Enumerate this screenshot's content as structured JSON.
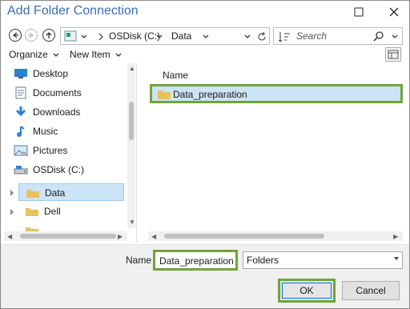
{
  "window": {
    "title": "Add Folder Connection"
  },
  "address": {
    "crumbs": [
      "OSDisk (C:)",
      "Data"
    ],
    "search_placeholder": "Search"
  },
  "toolbar": {
    "organize_label": "Organize",
    "new_item_label": "New Item"
  },
  "sidebar": {
    "items": [
      {
        "label": "Desktop",
        "icon": "desktop-icon"
      },
      {
        "label": "Documents",
        "icon": "documents-icon"
      },
      {
        "label": "Downloads",
        "icon": "downloads-icon"
      },
      {
        "label": "Music",
        "icon": "music-icon"
      },
      {
        "label": "Pictures",
        "icon": "pictures-icon"
      },
      {
        "label": "OSDisk (C:)",
        "icon": "drive-icon"
      },
      {
        "label": "Data",
        "icon": "folder-icon",
        "selected": true
      },
      {
        "label": "Dell",
        "icon": "folder-icon"
      }
    ]
  },
  "content": {
    "column_header": "Name",
    "rows": [
      {
        "name": "Data_preparation",
        "icon": "folder-icon",
        "selected": true
      }
    ]
  },
  "footer": {
    "name_label": "Name",
    "name_value": "Data_preparation",
    "type_value": "Folders",
    "ok_label": "OK",
    "cancel_label": "Cancel"
  },
  "colors": {
    "title": "#3b6fb5",
    "selection": "#cce4f7",
    "highlight": "#6fa43a",
    "folder": "#e8c25a"
  }
}
